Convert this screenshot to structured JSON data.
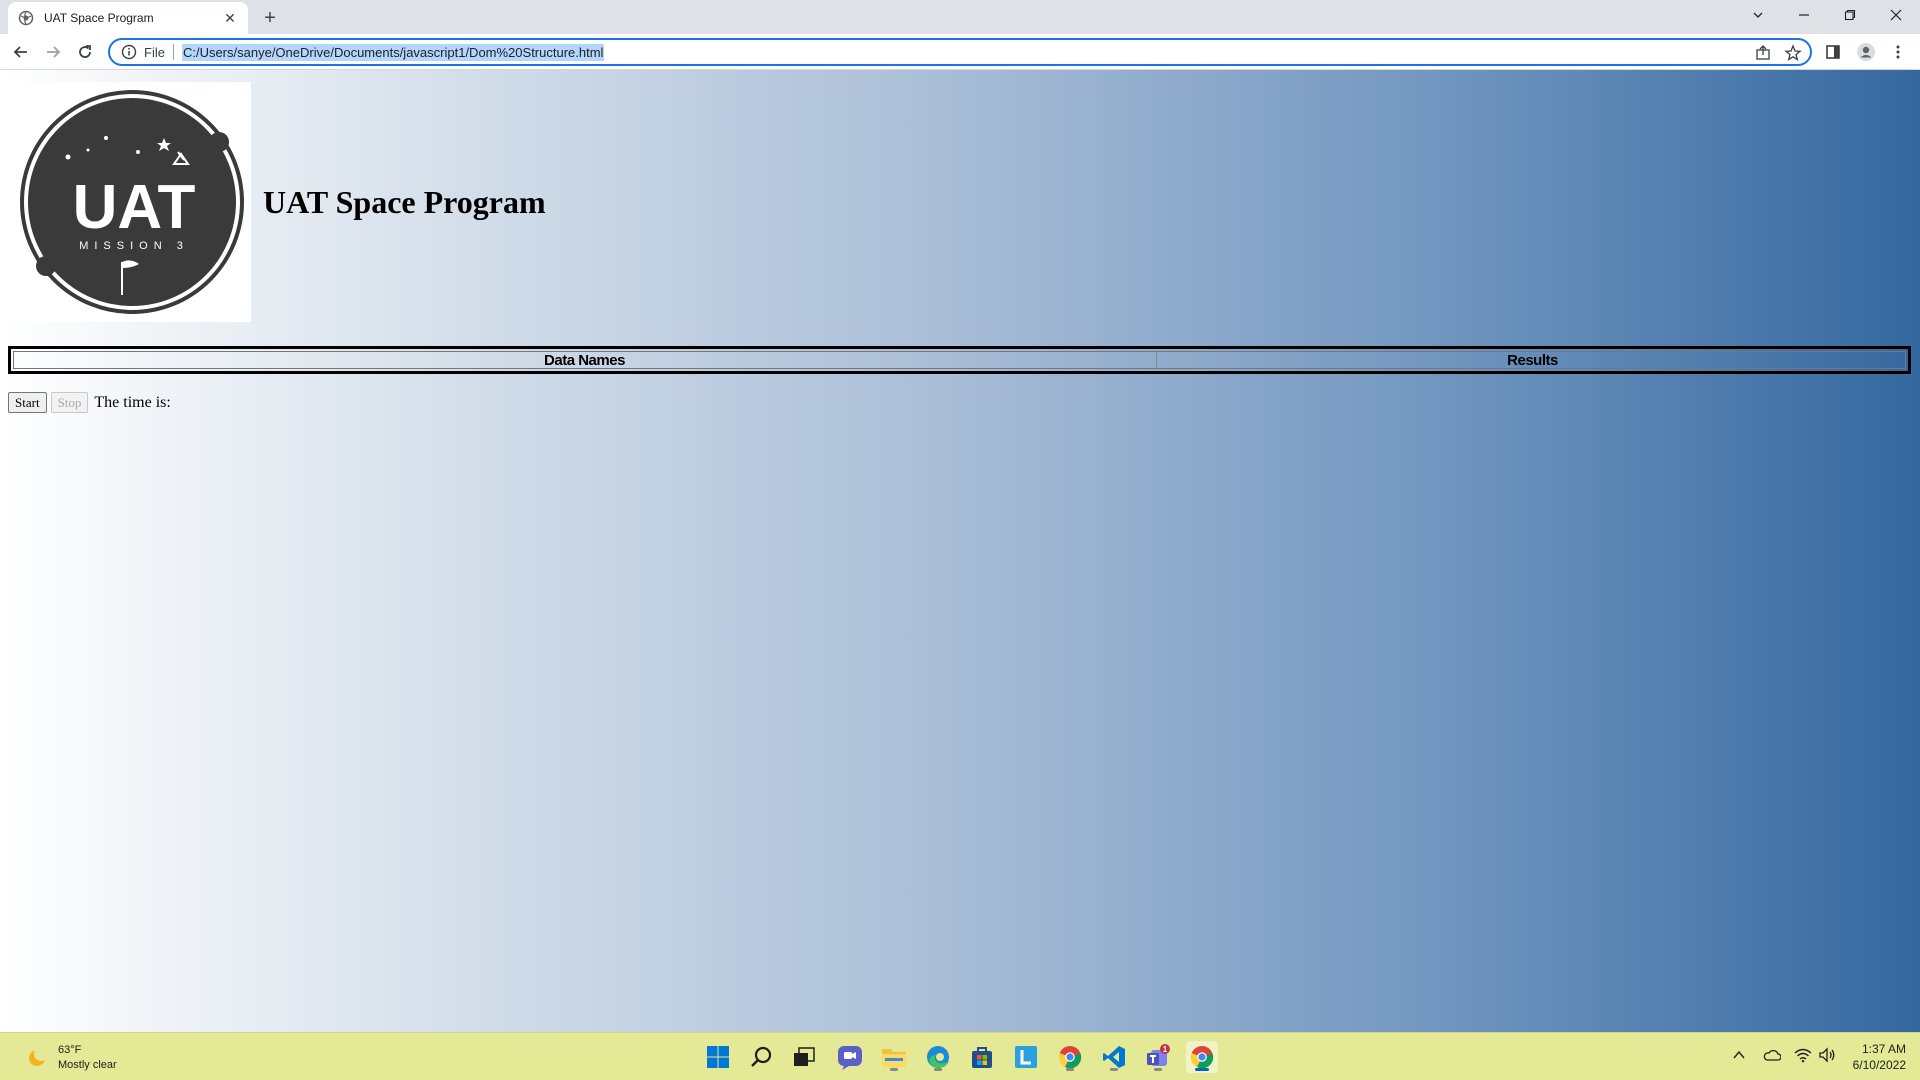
{
  "browser": {
    "tab_title": "UAT Space Program",
    "omnibox_scheme": "File",
    "url": "C:/Users/sanye/OneDrive/Documents/javascript1/Dom%20Structure.html"
  },
  "page": {
    "title": "UAT Space Program",
    "logo_text": "UAT",
    "logo_subtext": "MISSION 3",
    "table_headers": [
      "Data Names",
      "Results"
    ],
    "start_label": "Start",
    "stop_label": "Stop",
    "time_label": "The time is:"
  },
  "taskbar": {
    "temperature": "63°F",
    "weather_desc": "Mostly clear",
    "time": "1:37 AM",
    "date": "6/10/2022",
    "teams_badge": "1"
  },
  "colors": {
    "gradient_start": "#ffffff",
    "gradient_end": "#35689f",
    "omnibox_border": "#1a73e8",
    "taskbar_bg": "#e4e995"
  }
}
